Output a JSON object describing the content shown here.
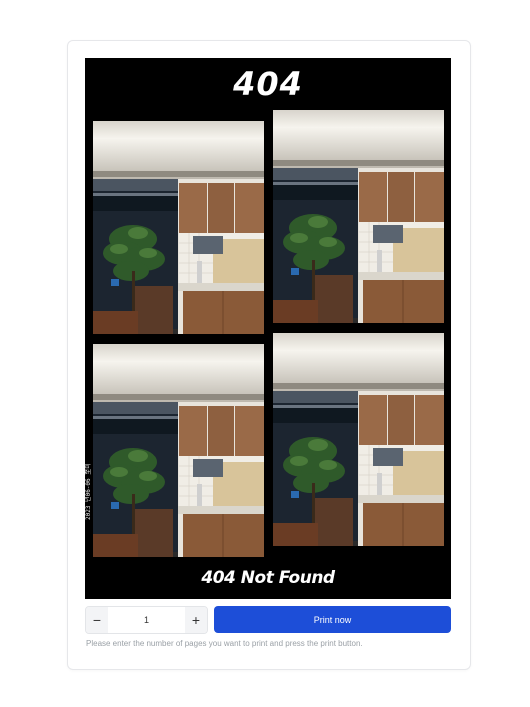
{
  "strip": {
    "title": "404",
    "footer_text": "404 Not Found",
    "date_stamp": "2023 년06-06 至미",
    "photos": [
      "office-kitchen-photo",
      "office-kitchen-photo",
      "office-kitchen-photo",
      "office-kitchen-photo"
    ]
  },
  "controls": {
    "decrement_label": "−",
    "increment_label": "+",
    "quantity_value": "1",
    "print_label": "Print now",
    "hint": "Please enter the number of pages you want to print and press the print button."
  },
  "colors": {
    "accent": "#1d4ed8",
    "strip_background": "#000000",
    "card_border": "#e6e7ea"
  }
}
